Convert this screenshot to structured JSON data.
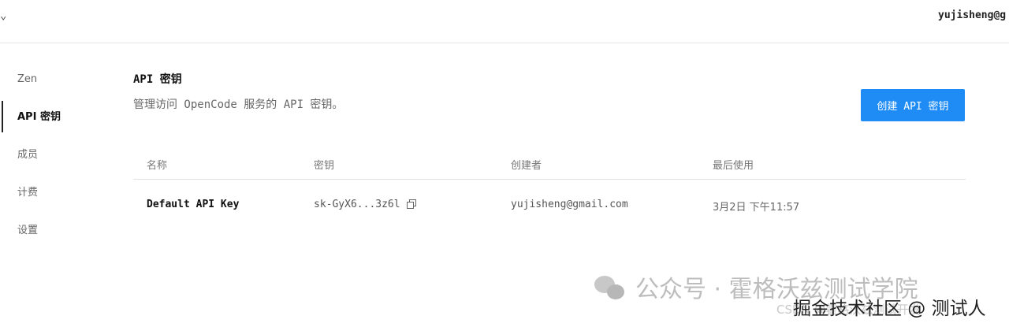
{
  "header": {
    "user_email": "yujisheng@g"
  },
  "sidebar": {
    "items": [
      {
        "label": "Zen"
      },
      {
        "label": "API 密钥"
      },
      {
        "label": "成员"
      },
      {
        "label": "计费"
      },
      {
        "label": "设置"
      }
    ],
    "active_index": 1
  },
  "main": {
    "title": "API 密钥",
    "subtitle": "管理访问 OpenCode 服务的 API 密钥。",
    "create_button_label": "创建 API 密钥"
  },
  "table": {
    "columns": [
      "名称",
      "密钥",
      "创建者",
      "最后使用"
    ],
    "rows": [
      {
        "name": "Default API Key",
        "key": "sk-GyX6...3z6l",
        "creator": "yujisheng@gmail.com",
        "last_used": "3月2日 下午11:57"
      }
    ]
  },
  "watermark": {
    "line1": "公众号 · 霍格沃兹测试学院",
    "line2": "掘金技术社区 @ 测试人",
    "line3": "CSDN @霍格沃兹测试开发"
  },
  "colors": {
    "accent": "#1f8cf5"
  },
  "icons": {
    "menu_chevron": "chevron-down-icon",
    "copy": "copy-icon",
    "wechat": "wechat-icon"
  }
}
